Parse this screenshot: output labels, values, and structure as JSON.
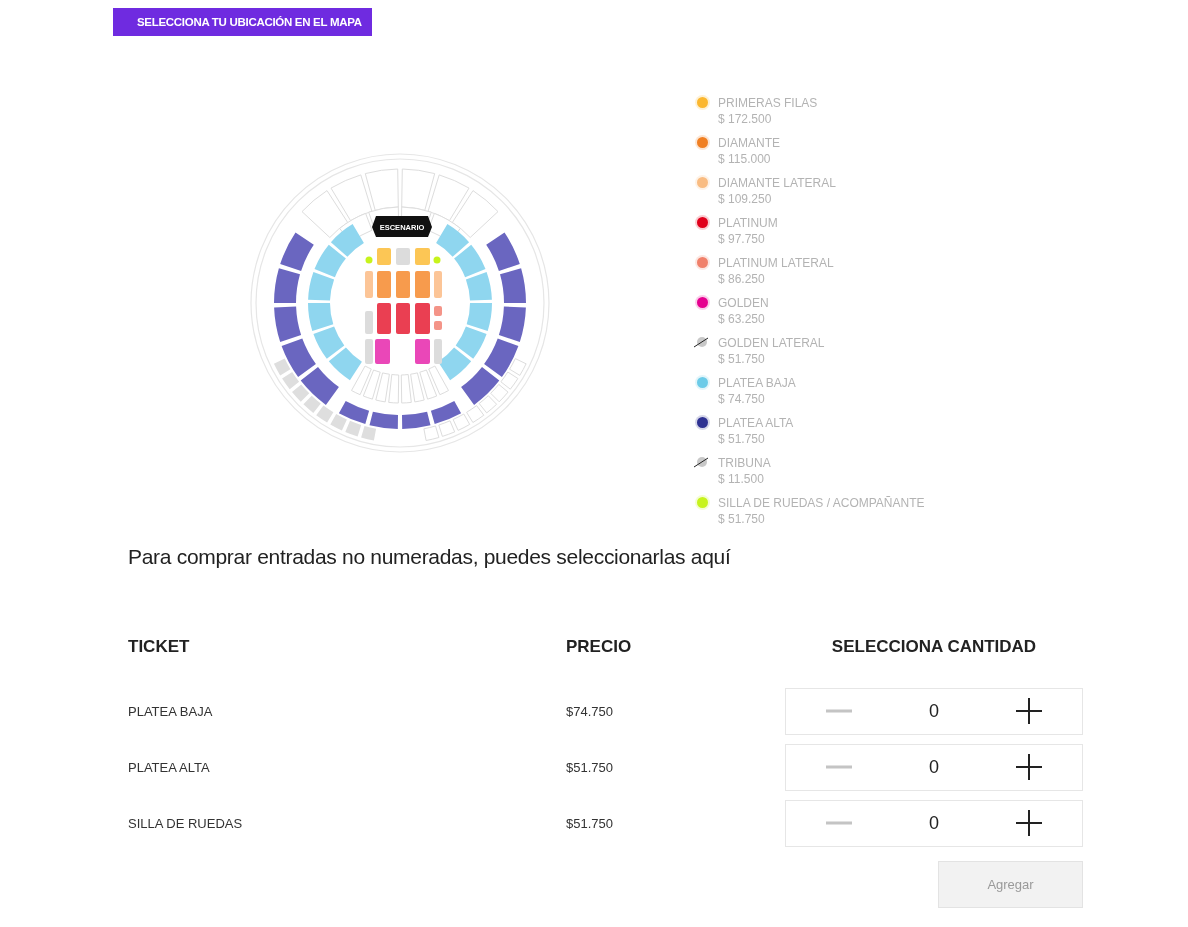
{
  "header_button": {
    "label": "SELECCIONA TU UBICACIÓN EN EL MAPA"
  },
  "map": {
    "stage_label": "ESCENARIO"
  },
  "legend": [
    {
      "kind": "dot",
      "name": "PRIMERAS FILAS",
      "price": "$ 172.500",
      "color": "#fbb72f"
    },
    {
      "kind": "dot",
      "name": "DIAMANTE",
      "price": "$ 115.000",
      "color": "#f07f22"
    },
    {
      "kind": "dot",
      "name": "DIAMANTE LATERAL",
      "price": "$ 109.250",
      "color": "#f9bc82"
    },
    {
      "kind": "dot",
      "name": "PLATINUM",
      "price": "$ 97.750",
      "color": "#e0001b"
    },
    {
      "kind": "dot",
      "name": "PLATINUM LATERAL",
      "price": "$ 86.250",
      "color": "#f0806a"
    },
    {
      "kind": "dot",
      "name": "GOLDEN",
      "price": "$ 63.250",
      "color": "#e5008f"
    },
    {
      "kind": "unavailable",
      "name": "GOLDEN LATERAL",
      "price": "$ 51.750",
      "color": "#c8c8c8"
    },
    {
      "kind": "dot",
      "name": "PLATEA BAJA",
      "price": "$ 74.750",
      "color": "#6ccbe8"
    },
    {
      "kind": "dot",
      "name": "PLATEA ALTA",
      "price": "$ 51.750",
      "color": "#2e3192"
    },
    {
      "kind": "unavailable",
      "name": "TRIBUNA",
      "price": "$ 11.500",
      "color": "#c8c8c8"
    },
    {
      "kind": "dot",
      "name": "SILLA DE RUEDAS / ACOMPAÑANTE",
      "price": "$ 51.750",
      "color": "#c7f31c"
    }
  ],
  "intro": "Para comprar entradas no numeradas, puedes seleccionarlas aquí",
  "table": {
    "columns": [
      "TICKET",
      "PRECIO",
      "SELECCIONA CANTIDAD"
    ],
    "rows": [
      {
        "ticket": "PLATEA BAJA",
        "price": "$74.750",
        "quantity": "0",
        "minus_disabled": true
      },
      {
        "ticket": "PLATEA ALTA",
        "price": "$51.750",
        "quantity": "0",
        "minus_disabled": true
      },
      {
        "ticket": "SILLA DE RUEDAS",
        "price": "$51.750",
        "quantity": "0",
        "minus_disabled": true
      }
    ]
  },
  "add_button": {
    "label": "Agregar",
    "disabled": true
  }
}
